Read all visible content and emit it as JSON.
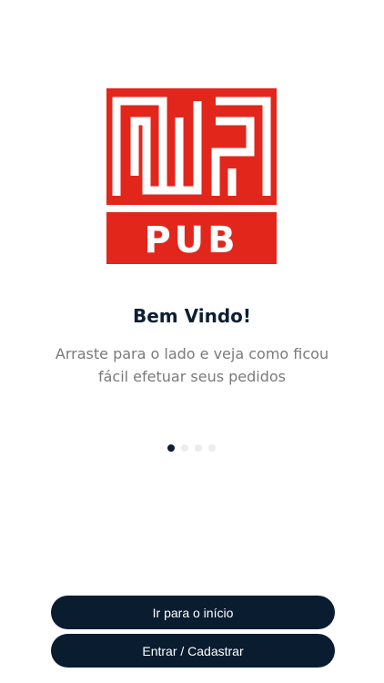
{
  "brand": {
    "logo_text": "PUB",
    "color": "#e3261c"
  },
  "welcome": {
    "title": "Bem Vindo!",
    "subtitle_line1": "Arraste para o lado e veja como ficou",
    "subtitle_line2": "fácil efetuar seus pedidos"
  },
  "pager": {
    "total": 4,
    "active": 1
  },
  "actions": {
    "start_label": "Ir para o início",
    "login_label": "Entrar / Cadastrar"
  },
  "colors": {
    "primary": "#0a1c30",
    "muted_text": "#7a7a7a",
    "inactive_dot": "#ececec"
  }
}
